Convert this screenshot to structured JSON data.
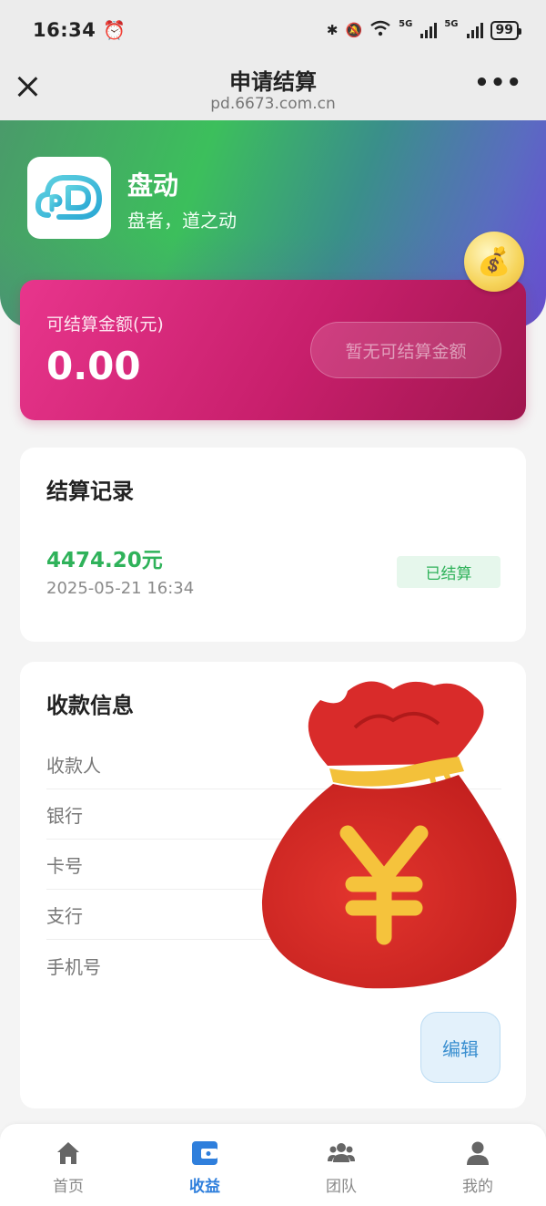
{
  "status_bar": {
    "time": "16:34",
    "battery": "99",
    "network_label": "5G"
  },
  "nav": {
    "title": "申请结算",
    "url": "pd.6673.com.cn",
    "more": "•••"
  },
  "app": {
    "name": "盘动",
    "slogan": "盘者，道之动"
  },
  "settlement": {
    "label": "可结算金额(元)",
    "amount": "0.00",
    "button_label": "暂无可结算金额"
  },
  "records": {
    "title": "结算记录",
    "items": [
      {
        "amount": "4474.20元",
        "time": "2025-05-21 16:34",
        "status": "已结算"
      }
    ]
  },
  "payee": {
    "title": "收款信息",
    "rows": [
      {
        "label": "收款人",
        "value": ""
      },
      {
        "label": "银行",
        "value": ""
      },
      {
        "label": "卡号",
        "value": ""
      },
      {
        "label": "支行",
        "value": ""
      },
      {
        "label": "手机号",
        "value": ""
      }
    ],
    "edit_label": "编辑"
  },
  "tabs": [
    {
      "label": "首页",
      "icon": "home-icon",
      "active": false
    },
    {
      "label": "收益",
      "icon": "wallet-icon",
      "active": true
    },
    {
      "label": "团队",
      "icon": "team-icon",
      "active": false
    },
    {
      "label": "我的",
      "icon": "user-icon",
      "active": false
    }
  ],
  "colors": {
    "accent": "#2f7fdc",
    "settle_card": "#d4267a",
    "success": "#2fb25a"
  }
}
